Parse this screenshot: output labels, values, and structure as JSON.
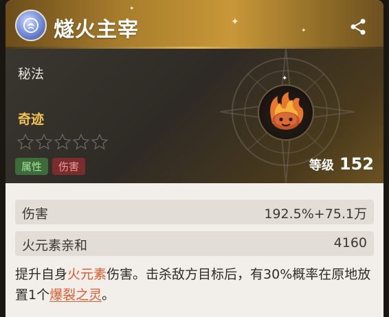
{
  "header": {
    "title": "燧火主宰",
    "title_icon": "element-emblem-icon",
    "share_icon": "share-icon"
  },
  "info": {
    "category": "秘法",
    "rarity_label": "奇迹",
    "stars_total": 5,
    "stars_filled": 0,
    "tags": [
      "属性",
      "伤害"
    ],
    "level_label": "等级",
    "level_value": "152"
  },
  "stats": [
    {
      "key": "伤害",
      "value": "192.5%+75.1万"
    },
    {
      "key": "火元素亲和",
      "value": "4160"
    }
  ],
  "description": {
    "p1": "提升自身",
    "hl1": "火元素",
    "p2": "伤害。击杀敌方目标后，有30%概率在原地放置1个",
    "link": "爆裂之灵",
    "p3": "。"
  },
  "colors": {
    "gold": "#c89738",
    "rarity": "#f3c451",
    "highlight": "#e05a2c"
  }
}
